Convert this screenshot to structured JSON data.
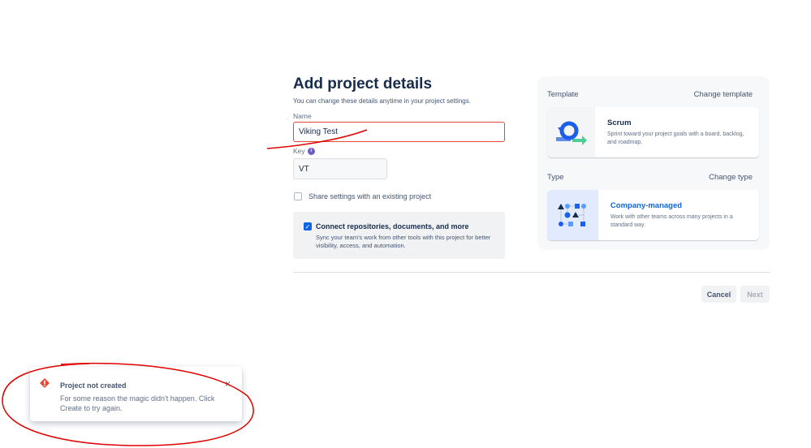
{
  "form": {
    "title": "Add project details",
    "subtitle": "You can change these details anytime in your project settings.",
    "name_label": "Name",
    "name_value": "Viking Test",
    "key_label": "Key",
    "key_value": "VT",
    "share_label": "Share settings with an existing project",
    "share_checked": false,
    "connect_label": "Connect repositories, documents, and more",
    "connect_desc": "Sync your team's work from other tools with this project for better visibility, access, and automation.",
    "connect_checked": true
  },
  "template": {
    "label": "Template",
    "change": "Change template",
    "name": "Scrum",
    "desc": "Sprint toward your project goals with a board, backlog, and roadmap."
  },
  "type": {
    "label": "Type",
    "change": "Change type",
    "name": "Company-managed",
    "desc": "Work with other teams across many projects in a standard way."
  },
  "footer": {
    "cancel": "Cancel",
    "next": "Next"
  },
  "toast": {
    "title": "Project not created",
    "message": "For some reason the magic didn't happen. Click Create to try again."
  },
  "colors": {
    "error": "#e34935",
    "primary": "#0c66e4",
    "annotation": "#e00000"
  }
}
